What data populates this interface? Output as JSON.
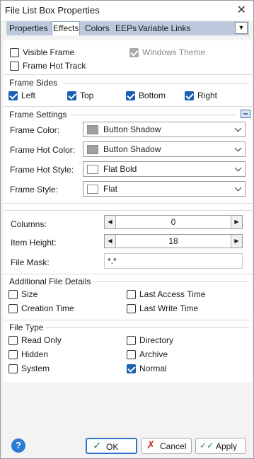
{
  "window": {
    "title": "File List Box Properties",
    "close_glyph": "✕"
  },
  "tabs": [
    {
      "label": "Properties",
      "active": false
    },
    {
      "label": "Effects",
      "active": true
    },
    {
      "label": "Colors",
      "active": false
    },
    {
      "label": "EEPs",
      "active": false
    },
    {
      "label": "Variable Links",
      "active": false
    }
  ],
  "tab_dropdown_glyph": "▼",
  "general": {
    "visible_frame": {
      "label": "Visible Frame",
      "checked": false
    },
    "windows_theme": {
      "label": "Windows Theme",
      "checked": true,
      "disabled": true
    },
    "frame_hot_track": {
      "label": "Frame Hot Track",
      "checked": false
    }
  },
  "frame_sides": {
    "heading": "Frame Sides",
    "items": [
      {
        "label": "Left",
        "checked": true
      },
      {
        "label": "Top",
        "checked": true
      },
      {
        "label": "Bottom",
        "checked": true
      },
      {
        "label": "Right",
        "checked": true
      }
    ]
  },
  "frame_settings": {
    "heading": "Frame Settings",
    "rows": [
      {
        "label": "Frame Color:",
        "value": "Button Shadow",
        "swatch": "#a0a0a0"
      },
      {
        "label": "Frame Hot Color:",
        "value": "Button Shadow",
        "swatch": "#a0a0a0"
      },
      {
        "label": "Frame Hot Style:",
        "value": "Flat Bold",
        "swatch": "#ffffff"
      },
      {
        "label": "Frame Style:",
        "value": "Flat",
        "swatch": "#ffffff"
      }
    ]
  },
  "layout": {
    "columns": {
      "label": "Columns:",
      "value": "0"
    },
    "item_height": {
      "label": "Item Height:",
      "value": "18"
    },
    "file_mask": {
      "label": "File Mask:",
      "value": "*.*"
    }
  },
  "spin_glyphs": {
    "left": "◀",
    "right": "▶"
  },
  "additional_details": {
    "heading": "Additional File Details",
    "items": [
      {
        "label": "Size",
        "checked": false
      },
      {
        "label": "Last Access Time",
        "checked": false
      },
      {
        "label": "Creation Time",
        "checked": false
      },
      {
        "label": "Last Write Time",
        "checked": false
      }
    ]
  },
  "file_type": {
    "heading": "File Type",
    "items": [
      {
        "label": "Read Only",
        "checked": false
      },
      {
        "label": "Directory",
        "checked": false
      },
      {
        "label": "Hidden",
        "checked": false
      },
      {
        "label": "Archive",
        "checked": false
      },
      {
        "label": "System",
        "checked": false
      },
      {
        "label": "Normal",
        "checked": true
      }
    ]
  },
  "footer": {
    "help_glyph": "?",
    "ok": {
      "label": "OK",
      "icon_glyph": "✓"
    },
    "cancel": {
      "label": "Cancel",
      "icon_glyph": "✗"
    },
    "apply": {
      "label": "Apply",
      "icon_glyph": "✓✓"
    }
  }
}
